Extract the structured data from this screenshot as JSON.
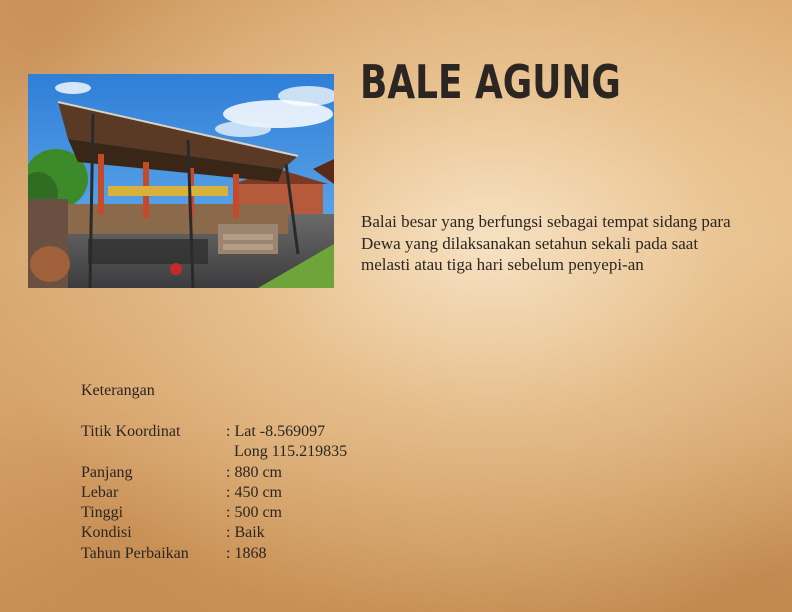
{
  "title": "BALE AGUNG",
  "description": "Balai besar yang berfungsi sebagai tempat sidang para Dewa yang dilaksanakan setahun sekali pada saat melasti atau tiga hari sebelum penyepi-an",
  "info": {
    "label": "Keterangan",
    "rows": [
      {
        "key": "Titik Koordinat",
        "value": ": Lat -8.569097",
        "value2": "Long 115.219835"
      },
      {
        "key": "Panjang",
        "value": ": 880 cm"
      },
      {
        "key": "Lebar",
        "value": ": 450 cm"
      },
      {
        "key": "Tinggi",
        "value": ": 500 cm"
      },
      {
        "key": "Kondisi",
        "value": ": Baik"
      },
      {
        "key": "Tahun Perbaikan",
        "value": ": 1868"
      }
    ]
  },
  "colors": {
    "text": "#2b2622",
    "background": "#e2b17a"
  }
}
